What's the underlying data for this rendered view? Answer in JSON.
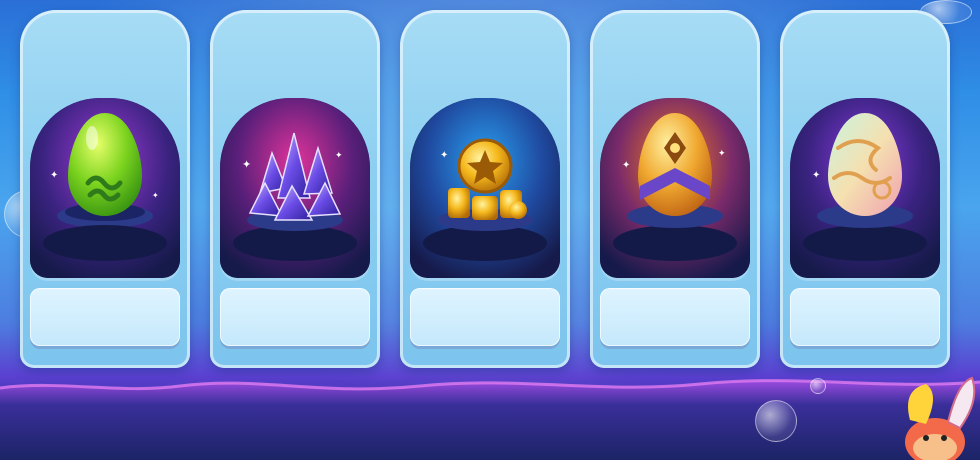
{
  "scene": {
    "colors": {
      "card": "#8fd0f1",
      "frame": "#1a1f55",
      "slot": "#d6efff"
    }
  },
  "rewards": [
    {
      "icon": "green-egg-icon",
      "label": ""
    },
    {
      "icon": "purple-crystals-icon",
      "label": ""
    },
    {
      "icon": "gold-coins-icon",
      "label": ""
    },
    {
      "icon": "golden-egg-icon",
      "label": ""
    },
    {
      "icon": "pastel-egg-icon",
      "label": ""
    }
  ]
}
